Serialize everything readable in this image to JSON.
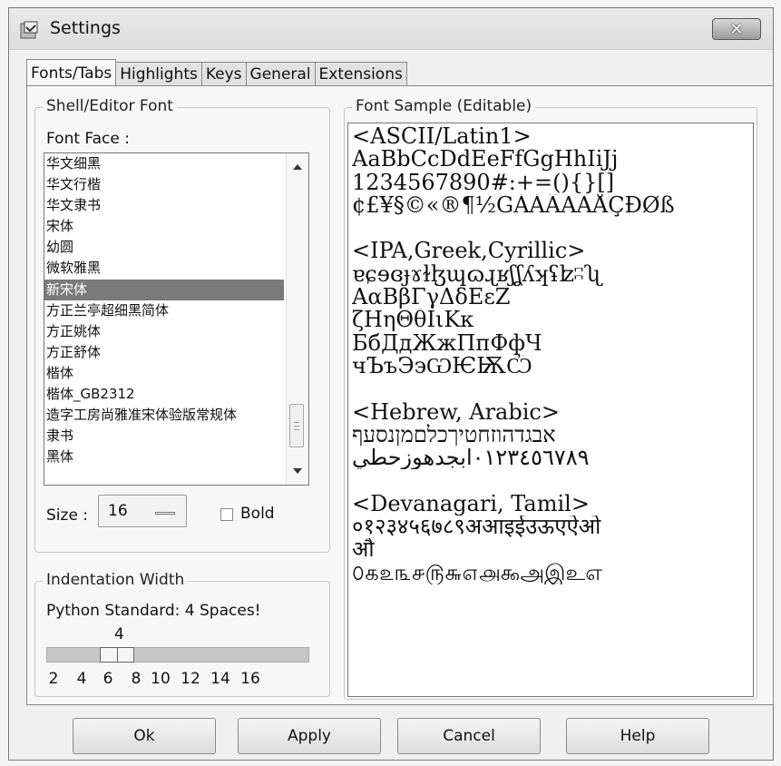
{
  "window": {
    "title": "Settings",
    "close_icon": "close-x-icon"
  },
  "tabs": [
    {
      "label": "Fonts/Tabs",
      "active": true
    },
    {
      "label": "Highlights",
      "active": false
    },
    {
      "label": "Keys",
      "active": false
    },
    {
      "label": "General",
      "active": false
    },
    {
      "label": "Extensions",
      "active": false
    }
  ],
  "font_group": {
    "title": "Shell/Editor Font",
    "face_label": "Font Face :",
    "font_list": [
      "华文细黑",
      "华文行楷",
      "华文隶书",
      "宋体",
      "幼圆",
      "微软雅黑",
      "新宋体",
      "方正兰亭超细黑简体",
      "方正姚体",
      "方正舒体",
      "楷体",
      "楷体_GB2312",
      "造字工房尚雅准宋体验版常规体",
      "隶书",
      "黑体"
    ],
    "selected_index": 6,
    "size_label": "Size :",
    "size_value": "16",
    "bold_label": "Bold",
    "bold_checked": false
  },
  "indent_group": {
    "title": "Indentation Width",
    "description": "Python Standard: 4 Spaces!",
    "value": "4",
    "ticks": [
      "2",
      "4",
      "6",
      "8",
      "10",
      "12",
      "14",
      "16"
    ]
  },
  "sample_group": {
    "title": "Font Sample (Editable)",
    "lines": [
      "<ASCII/Latin1>",
      "AaBbCcDdEeFfGgHhIiJj",
      "1234567890#:+=(){}[]",
      "¢£¥§©«®¶½ĞÀÁÂÃÄÅÇÐØß",
      "",
      "<IPA,Greek,Cyrillic>",
      "ɐɕɘɞɟɤɫɮɰɷɻʁʃʆʎʞʢʫʭʯ",
      "ΑαΒβΓγΔδΕεΖ",
      "ζΗηΘθΙιΚκ",
      "БбДдЖжПпФфЧ",
      "чЪъЭэѠѤѬѼ",
      "",
      "<Hebrew, Arabic>",
      "אבגדהוזחטיךכלםמןנסעף",
      "٠١٢٣٤٥٦٧٨٩ابجدهوزحطي",
      "",
      "<Devanagari, Tamil>",
      "०१२३४५६७८९अआइईउऊएऐओ",
      "औ",
      "௦௧௨௩௪௫௬௭௮௯அஇஉஎ"
    ]
  },
  "buttons": {
    "ok": "Ok",
    "apply": "Apply",
    "cancel": "Cancel",
    "help": "Help"
  }
}
